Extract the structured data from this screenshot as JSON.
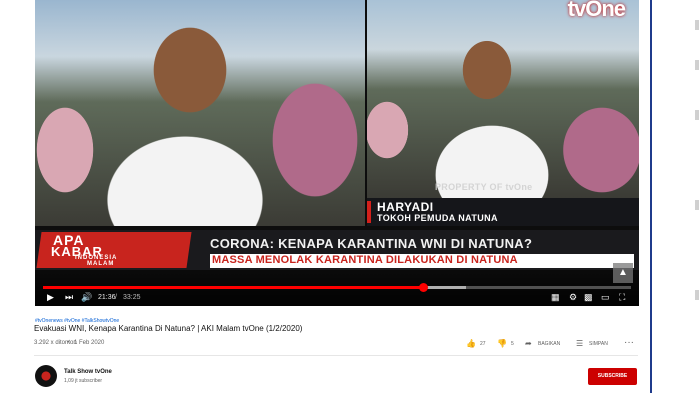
{
  "video": {
    "overlay_logo": "tvOne",
    "watermark": "PROPERTY OF tvOne",
    "caption": {
      "name": "HARYADI",
      "role": "TOKOH PEMUDA NATUNA"
    },
    "ticker": {
      "program_line1": "APA",
      "program_line2": "KABAR",
      "program_line3": "INDONESIA",
      "program_line4": "MALAM",
      "headline": "CORONA: KENAPA KARANTINA WNI DI NATUNA?",
      "subheadline": "MASSA MENOLAK KARANTINA DILAKUKAN DI NATUNA"
    },
    "player": {
      "time_current": "21:36",
      "time_separator": "/",
      "time_total": "33:25",
      "progress_fraction": 0.646,
      "buffered_fraction": 0.72,
      "accent_color": "#ff0000",
      "icons": [
        "play-icon",
        "next-icon",
        "volume-icon",
        "subtitles-icon",
        "settings-icon",
        "miniplayer-icon",
        "theater-icon",
        "fullscreen-icon"
      ]
    }
  },
  "info": {
    "hashtags": "#tvOnenews #tvOne #TalkShowtvOne",
    "title": "Evakuasi WNI, Kenapa Karantina Di Natuna? | AKI Malam tvOne (1/2/2020)",
    "views": "3.292 x ditonton",
    "views_separator": "•",
    "date": "1 Feb 2020",
    "likes": "27",
    "dislikes": "5",
    "share_label": "BAGIKAN",
    "save_label": "SIMPAN",
    "more_label": "···"
  },
  "channel": {
    "name": "Talk Show tvOne",
    "subscribers": "1,09 jt subscriber",
    "subscribe_label": "SUBSCRIBE",
    "subscribe_color": "#cc0000"
  }
}
